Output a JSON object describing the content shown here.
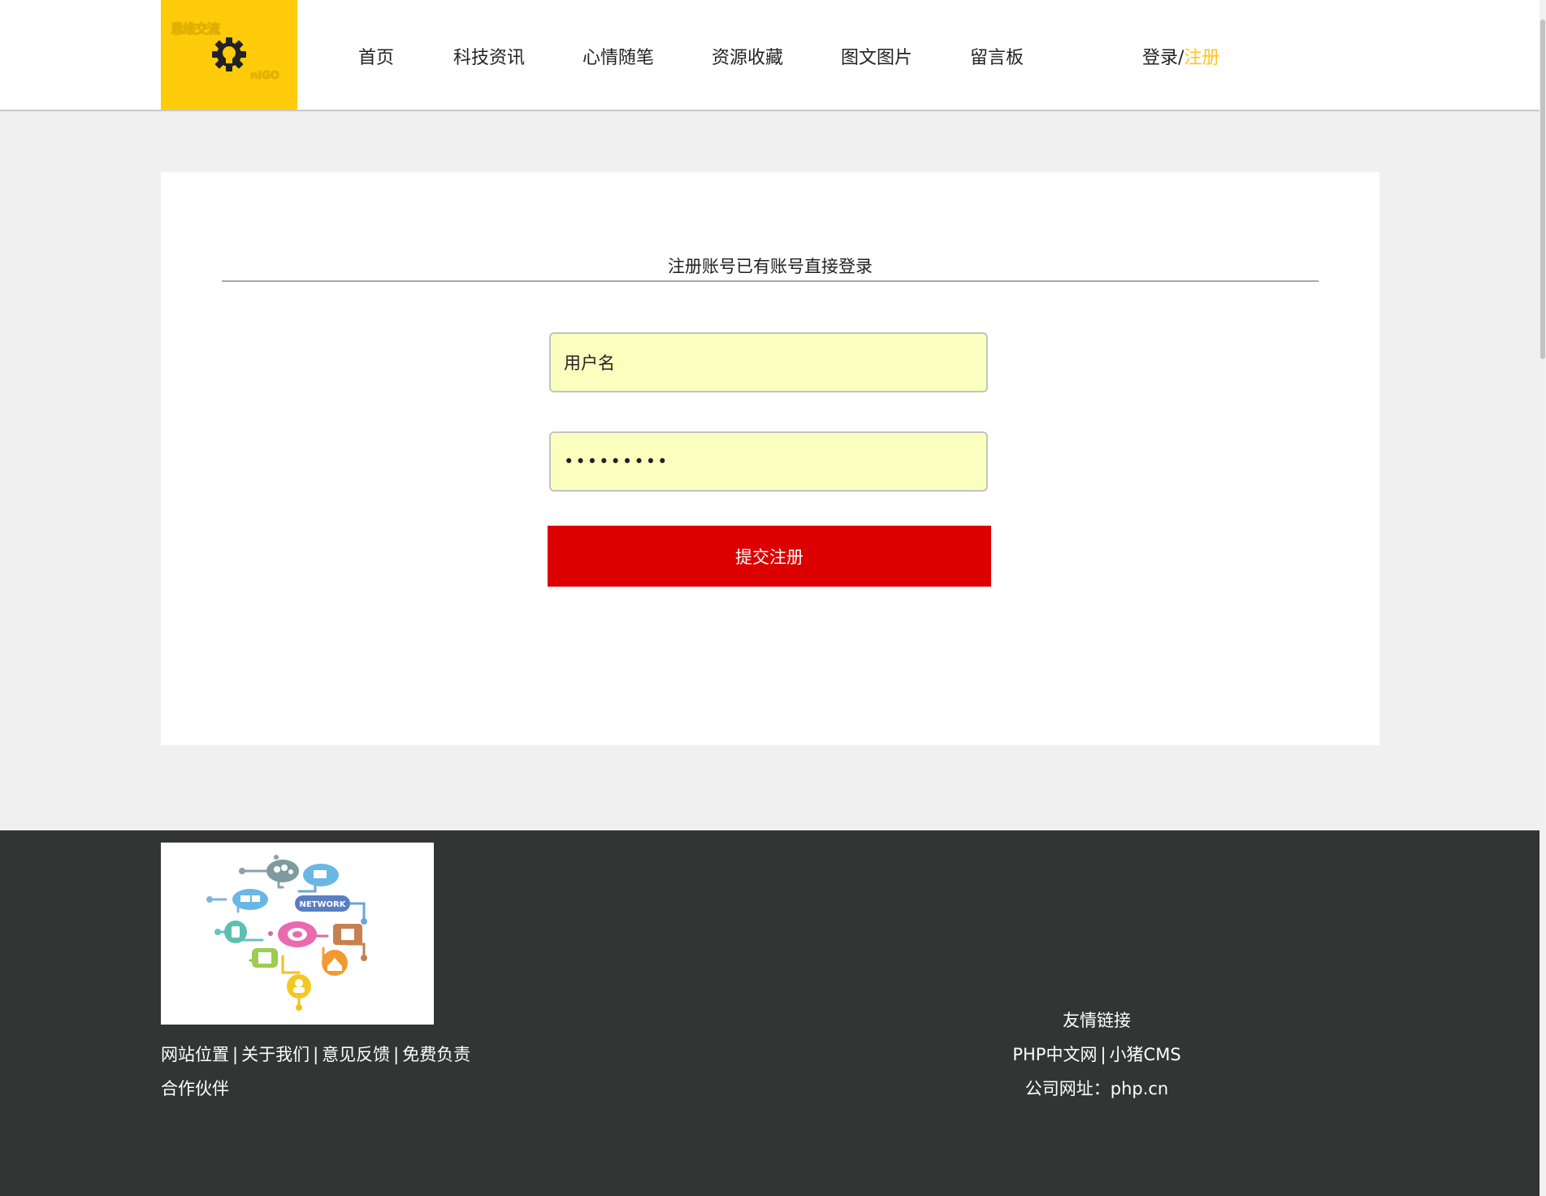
{
  "logo": {
    "top_text": "思维交流",
    "bottom_text": "nIGO"
  },
  "nav": {
    "items": [
      {
        "label": "首页"
      },
      {
        "label": "科技资讯"
      },
      {
        "label": "心情随笔"
      },
      {
        "label": "资源收藏"
      },
      {
        "label": "图文图片"
      },
      {
        "label": "留言板"
      }
    ],
    "login": "登录/",
    "register": "注册"
  },
  "colors": {
    "brand_yellow": "#ffcb0b",
    "submit_red": "#dc0000",
    "autofill_bg": "#faffbd",
    "footer_bg": "#333434"
  },
  "form": {
    "title": "注册账号已有账号直接登录",
    "username_value": "用户名",
    "password_value": "123456789",
    "submit_label": "提交注册"
  },
  "footer": {
    "image_label": "NETWORK",
    "links": [
      "网站位置",
      "关于我们",
      "意见反馈",
      "免费负责"
    ],
    "partner": "合作伙伴",
    "friend_title": "友情链接",
    "friend_links": [
      "PHP中文网",
      "小猪CMS"
    ],
    "company_label": "公司网址：",
    "company_url": "php.cn"
  }
}
